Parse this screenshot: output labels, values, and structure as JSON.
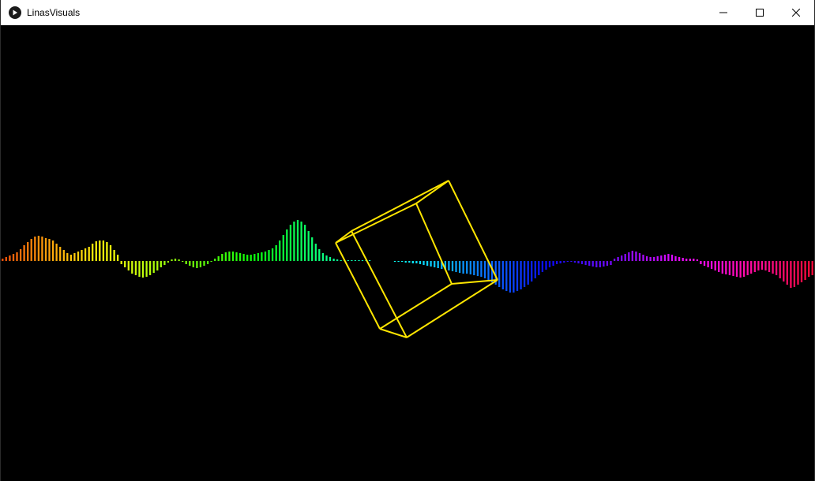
{
  "window": {
    "title": "LinasVisuals",
    "minimize_icon": "minimize-icon",
    "maximize_icon": "maximize-icon",
    "close_icon": "close-icon",
    "app_icon": "play-icon"
  },
  "visualizer": {
    "background": "#000000",
    "cube_color": "#ffe600",
    "bars": [
      3,
      5,
      7,
      9,
      11,
      15,
      20,
      24,
      28,
      31,
      32,
      31,
      29,
      28,
      26,
      22,
      18,
      14,
      10,
      8,
      10,
      12,
      14,
      16,
      18,
      22,
      25,
      26,
      26,
      24,
      20,
      14,
      8,
      -4,
      -8,
      -12,
      -16,
      -18,
      -20,
      -21,
      -20,
      -18,
      -15,
      -12,
      -8,
      -5,
      -2,
      2,
      3,
      2,
      -1,
      -4,
      -6,
      -8,
      -9,
      -8,
      -6,
      -4,
      -1,
      3,
      6,
      9,
      11,
      12,
      12,
      11,
      10,
      9,
      8,
      8,
      9,
      10,
      11,
      12,
      14,
      16,
      20,
      26,
      33,
      40,
      46,
      50,
      52,
      50,
      46,
      38,
      30,
      22,
      15,
      10,
      7,
      5,
      3,
      2,
      1,
      1,
      1,
      1,
      1,
      1,
      1,
      1,
      1,
      0,
      0,
      0,
      0,
      0,
      0,
      -1,
      -1,
      -1,
      -2,
      -2,
      -3,
      -3,
      -4,
      -5,
      -6,
      -7,
      -8,
      -9,
      -10,
      -11,
      -12,
      -13,
      -14,
      -15,
      -16,
      -16,
      -17,
      -18,
      -19,
      -20,
      -22,
      -24,
      -27,
      -30,
      -33,
      -36,
      -38,
      -40,
      -40,
      -38,
      -36,
      -33,
      -30,
      -26,
      -22,
      -18,
      -14,
      -11,
      -8,
      -6,
      -4,
      -3,
      -2,
      -1,
      -1,
      -2,
      -3,
      -4,
      -5,
      -6,
      -7,
      -8,
      -8,
      -7,
      -6,
      -5,
      3,
      5,
      7,
      9,
      11,
      13,
      12,
      10,
      8,
      6,
      5,
      5,
      6,
      7,
      8,
      9,
      8,
      6,
      5,
      4,
      3,
      3,
      3,
      2,
      -4,
      -6,
      -8,
      -10,
      -12,
      -14,
      -16,
      -17,
      -18,
      -19,
      -20,
      -21,
      -20,
      -18,
      -16,
      -14,
      -12,
      -11,
      -12,
      -14,
      -16,
      -18,
      -22,
      -26,
      -30,
      -34,
      -33,
      -30,
      -27,
      -24,
      -20,
      -18
    ]
  }
}
